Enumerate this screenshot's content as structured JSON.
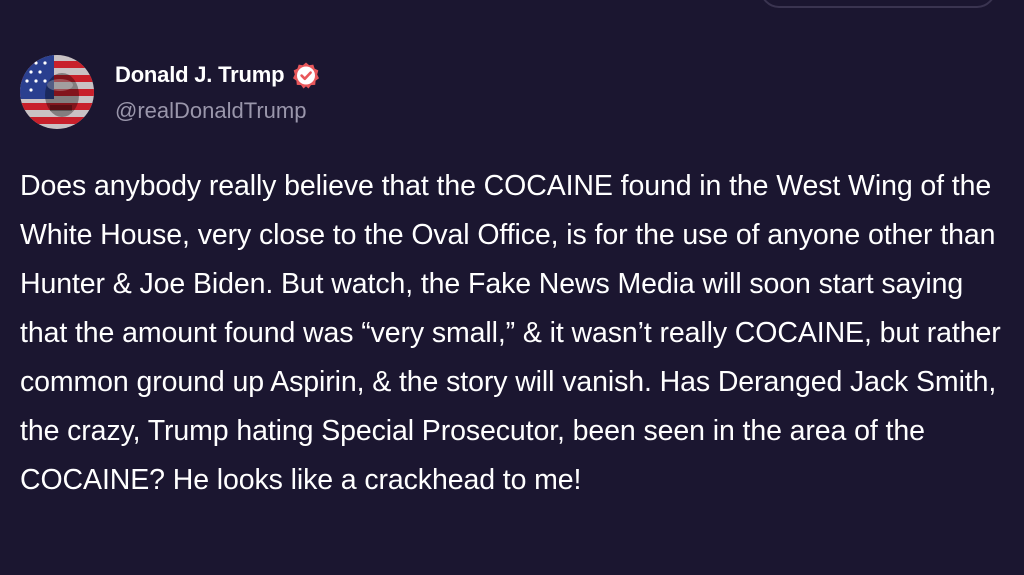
{
  "author": {
    "display_name": "Donald J. Trump",
    "handle": "@realDonaldTrump",
    "verified": true,
    "verified_badge_color": "#e8575b",
    "avatar_icon": "flag-portrait-avatar"
  },
  "post": {
    "text": "Does anybody really believe that the COCAINE found in the West Wing of the White House, very close to the Oval Office, is for the use of anyone other than Hunter & Joe Biden. But watch, the Fake News Media will soon start saying that the amount found was “very small,” & it wasn’t really COCAINE, but rather common ground up Aspirin, & the story will vanish. Has Deranged Jack Smith, the crazy, Trump hating Special Prosecutor, been seen in the area of the COCAINE? He looks like a crackhead to me!"
  },
  "theme": {
    "background": "#1b1630",
    "text_primary": "#ffffff",
    "text_secondary": "#9a96ab"
  }
}
